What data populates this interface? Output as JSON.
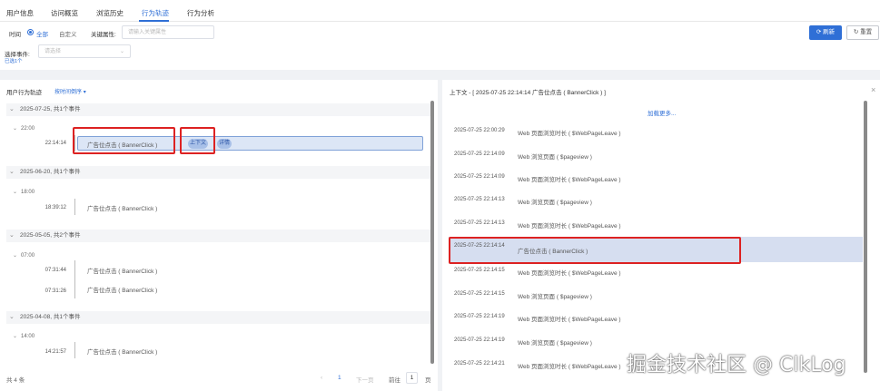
{
  "tabs": [
    "用户信息",
    "访问概览",
    "浏览历史",
    "行为轨迹",
    "行为分析"
  ],
  "active_tab": "行为轨迹",
  "filters": {
    "time_label": "时间",
    "time_all": "全部",
    "time_custom": "自定义",
    "keyword_label": "关键属性:",
    "keyword_placeholder": "请输入关键属性",
    "event_label": "选择事件:",
    "event_placeholder": "请选择",
    "selected_count": "已选1个",
    "refresh_label": "刷新",
    "reset_label": "重置"
  },
  "left": {
    "title": "用户行为轨迹",
    "sort_label": "按时间倒序",
    "groups": [
      {
        "date_text": "2025-07-25, 共1个事件",
        "hour": "22:00",
        "events": [
          {
            "time": "22:14:14",
            "name": "广告位点击 ( BannerClick )"
          }
        ]
      },
      {
        "date_text": "2025-06-20, 共1个事件",
        "hour": "18:00",
        "events": [
          {
            "time": "18:39:12",
            "name": "广告位点击 ( BannerClick )"
          }
        ]
      },
      {
        "date_text": "2025-05-05, 共2个事件",
        "hour": "07:00",
        "events": [
          {
            "time": "07:31:44",
            "name": "广告位点击 ( BannerClick )"
          },
          {
            "time": "07:31:26",
            "name": "广告位点击 ( BannerClick )"
          }
        ]
      },
      {
        "date_text": "2025-04-08, 共1个事件",
        "hour": "14:00",
        "events": [
          {
            "time": "14:21:57",
            "name": "广告位点击 ( BannerClick )"
          }
        ]
      }
    ],
    "context_btn": "上下文",
    "detail_btn": "详情",
    "pagination": {
      "total": "共 4 条",
      "prev": "‹",
      "page": "1",
      "next": "下一页",
      "goto": "前往",
      "goto_value": "1",
      "unit": "页"
    }
  },
  "right": {
    "title": "上下文 - [ 2025-07-25 22:14:14 广告位点击 ( BannerClick ) ]",
    "close": "×",
    "load_more": "加载更多...",
    "rows": [
      {
        "time": "2025-07-25 22:00:29",
        "name": "Web 页面浏览时长 ( $WebPageLeave )"
      },
      {
        "time": "2025-07-25 22:14:09",
        "name": "Web 浏览页面 ( $pageview )"
      },
      {
        "time": "2025-07-25 22:14:09",
        "name": "Web 页面浏览时长 ( $WebPageLeave )"
      },
      {
        "time": "2025-07-25 22:14:13",
        "name": "Web 浏览页面 ( $pageview )"
      },
      {
        "time": "2025-07-25 22:14:13",
        "name": "Web 页面浏览时长 ( $WebPageLeave )"
      },
      {
        "time": "2025-07-25 22:14:14",
        "name": "广告位点击 ( BannerClick )",
        "selected": true
      },
      {
        "time": "2025-07-25 22:14:15",
        "name": "Web 页面浏览时长 ( $WebPageLeave )"
      },
      {
        "time": "2025-07-25 22:14:15",
        "name": "Web 浏览页面 ( $pageview )"
      },
      {
        "time": "2025-07-25 22:14:19",
        "name": "Web 页面浏览时长 ( $WebPageLeave )"
      },
      {
        "time": "2025-07-25 22:14:19",
        "name": "Web 浏览页面 ( $pageview )"
      },
      {
        "time": "2025-07-25 22:14:21",
        "name": "Web 页面浏览时长 ( $WebPageLeave )"
      }
    ]
  },
  "watermark": "掘金技术社区 @ ClkLog",
  "colors": {
    "accent": "#2f6fd6",
    "highlight": "#d22222",
    "selected_row": "#d6def0"
  }
}
